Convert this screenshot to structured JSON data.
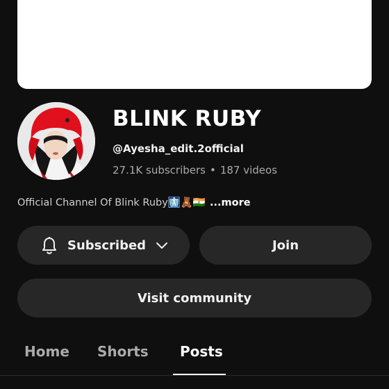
{
  "channel": {
    "name": "BLINK RUBY",
    "handle": "@Ayesha_edit.2official",
    "subscribers": "27.1K subscribers",
    "separator": "•",
    "videos": "187 videos",
    "description": "Official Channel Of Blink Ruby🩻🧸🇮🇳",
    "more_label": "...more"
  },
  "buttons": {
    "subscribed_label": "Subscribed",
    "join_label": "Join",
    "visit_community_label": "Visit community"
  },
  "tabs": [
    {
      "label": "Home",
      "active": false
    },
    {
      "label": "Shorts",
      "active": false
    },
    {
      "label": "Posts",
      "active": true
    }
  ],
  "icons": {
    "subscribed": "bell-icon",
    "dropdown": "chevron-down-icon"
  },
  "colors": {
    "background": "#0f0f0f",
    "button": "#272727",
    "muted_text": "#aaaaaa",
    "avatar_hat": "#e0101c"
  }
}
